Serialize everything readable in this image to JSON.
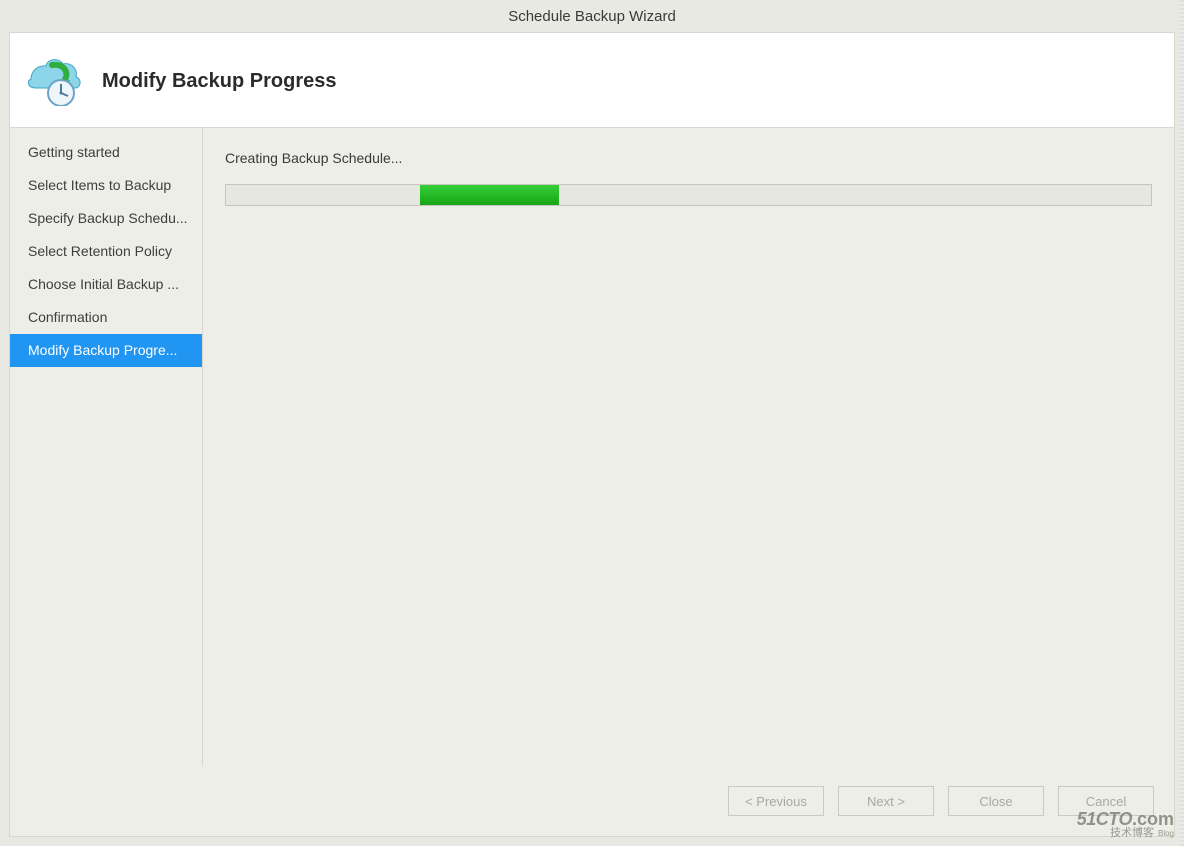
{
  "window": {
    "title": "Schedule Backup Wizard"
  },
  "header": {
    "title": "Modify Backup Progress"
  },
  "sidebar": {
    "items": [
      {
        "label": "Getting started",
        "selected": false
      },
      {
        "label": "Select Items to Backup",
        "selected": false
      },
      {
        "label": "Specify Backup Schedu...",
        "selected": false
      },
      {
        "label": "Select Retention Policy",
        "selected": false
      },
      {
        "label": "Choose Initial Backup ...",
        "selected": false
      },
      {
        "label": "Confirmation",
        "selected": false
      },
      {
        "label": "Modify Backup Progre...",
        "selected": true
      }
    ]
  },
  "content": {
    "status_label": "Creating Backup Schedule...",
    "progress": {
      "indeterminate": true,
      "bar_left_percent": 21,
      "bar_width_percent": 15
    }
  },
  "footer": {
    "buttons": {
      "previous": "< Previous",
      "next": "Next >",
      "close": "Close",
      "cancel": "Cancel"
    },
    "buttons_enabled": {
      "previous": false,
      "next": false,
      "close": false,
      "cancel": false
    }
  },
  "watermark": {
    "line1_a": "51CTO",
    "line1_b": ".com",
    "line2": "技术博客",
    "line2_tag": "Blog"
  }
}
